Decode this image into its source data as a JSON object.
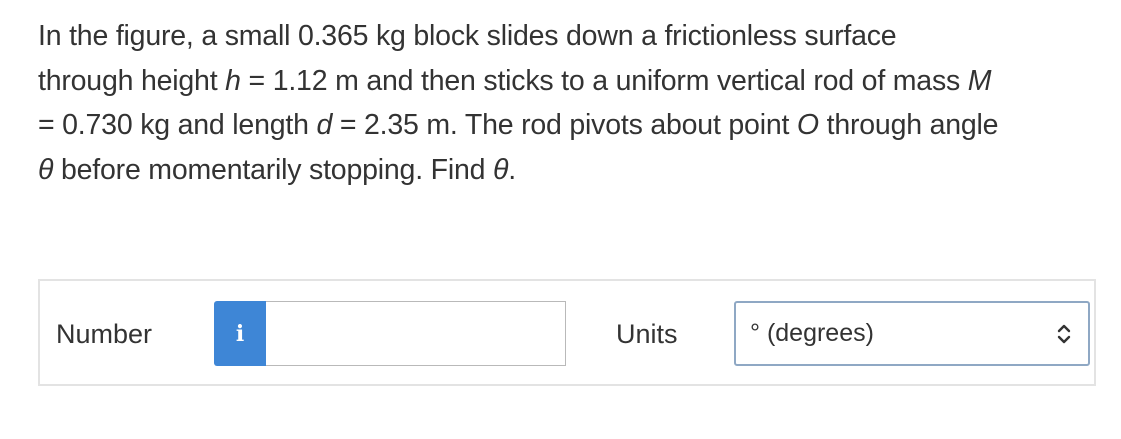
{
  "question": {
    "line1": "In the figure, a small 0.365 kg block slides down a frictionless surface",
    "line2_pre": "through height ",
    "var_h": "h",
    "line2_mid": " = 1.12 m and then sticks to a uniform vertical rod of mass ",
    "var_M": "M",
    "line3_pre": "= 0.730 kg and length ",
    "var_d": "d",
    "line3_mid": " = 2.35 m. The rod pivots about point ",
    "var_O": "O",
    "line3_post": " through angle",
    "var_theta": "θ",
    "line4_post": " before momentarily stopping. Find ",
    "var_theta2": "θ",
    "line4_end": "."
  },
  "answer": {
    "number_label": "Number",
    "info_icon": "i",
    "number_value": "",
    "units_label": "Units",
    "units_selected": "° (degrees)"
  },
  "colors": {
    "info_button": "#3e86d6",
    "text": "#333333",
    "select_border": "#8fa8c4"
  },
  "icons": {
    "info": "info-icon",
    "chevron": "chevron-up-down-icon"
  }
}
